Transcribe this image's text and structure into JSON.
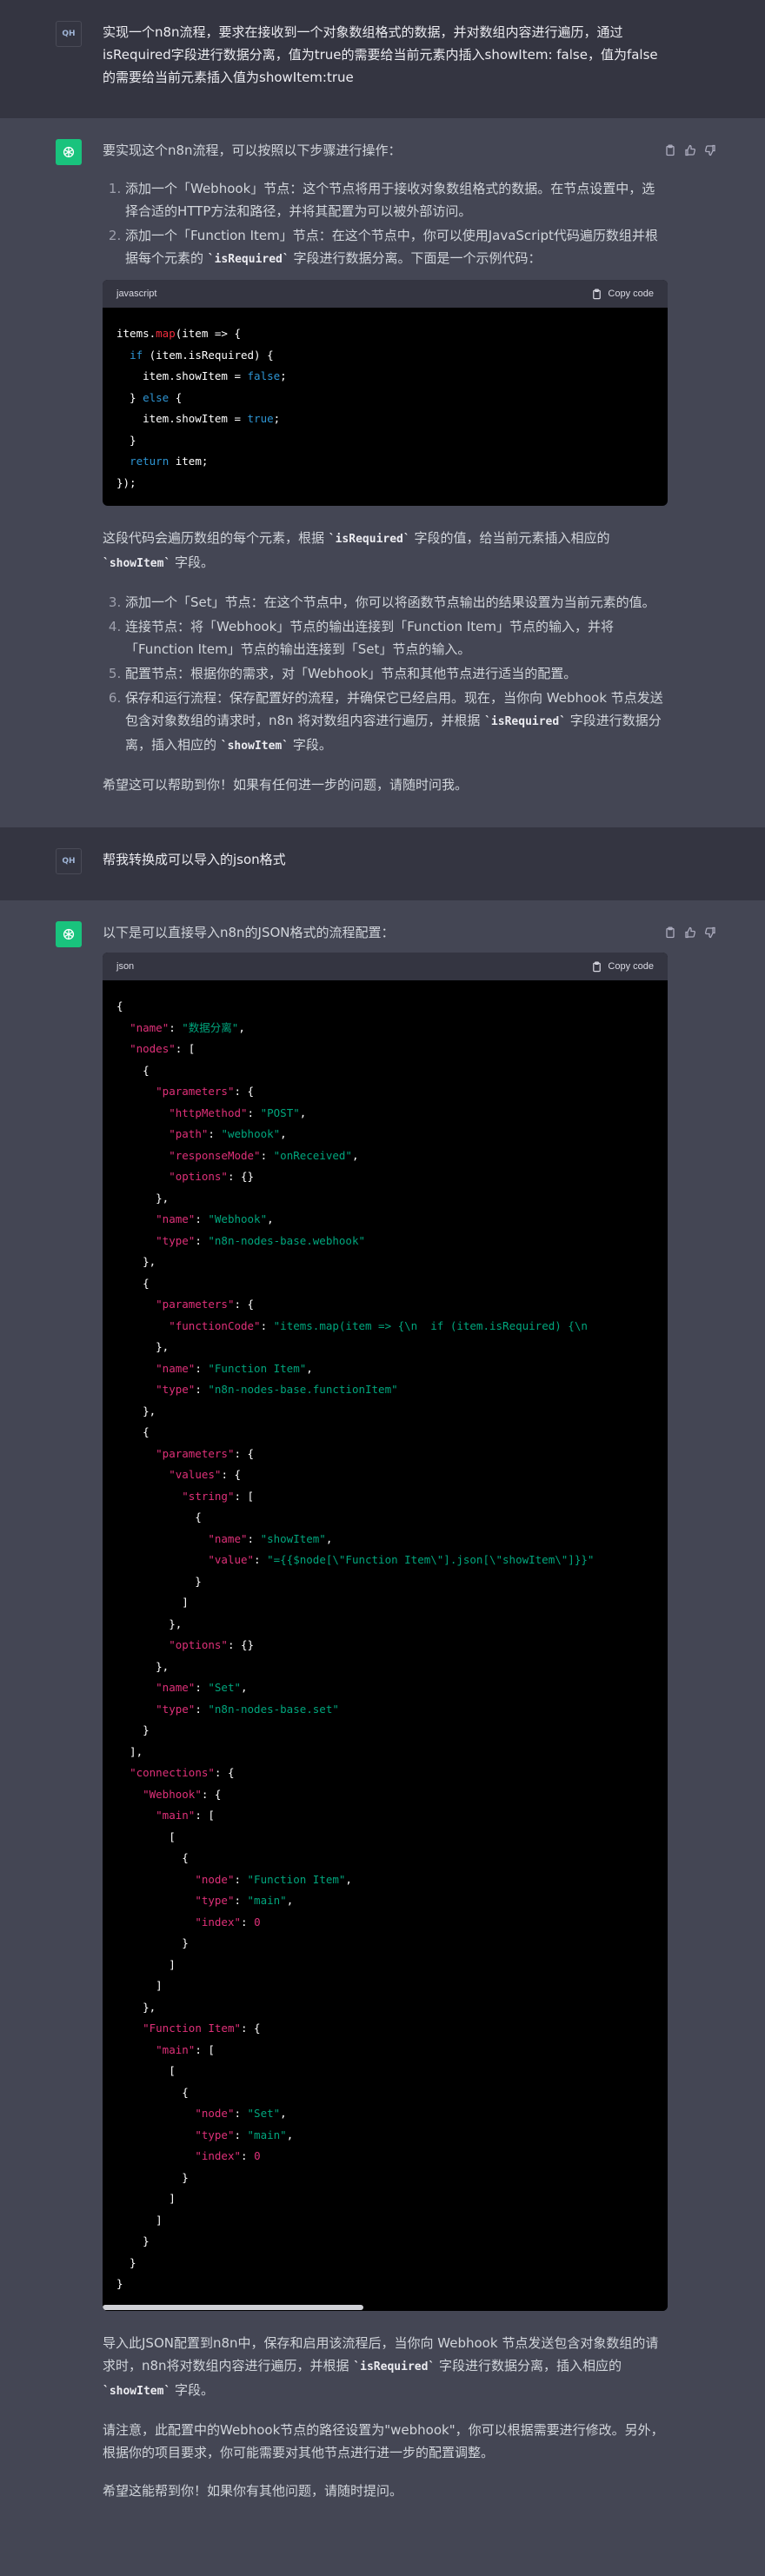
{
  "conversation": {
    "user_avatar": "QH",
    "msg1": {
      "text": "实现一个n8n流程，要求在接收到一个对象数组格式的数据，并对数组内容进行遍历，通过isRequired字段进行数据分离，值为true的需要给当前元素内插入showItem: false，值为false的需要给当前元素插入值为showItem:true"
    },
    "reply1": {
      "intro": "要实现这个n8n流程，可以按照以下步骤进行操作：",
      "steps_a": [
        "添加一个「Webhook」节点：这个节点将用于接收对象数组格式的数据。在节点设置中，选择合适的HTTP方法和路径，并将其配置为可以被外部访问。",
        "添加一个「Function Item」节点：在这个节点中，你可以使用JavaScript代码遍历数组并根据每个元素的 `isRequired` 字段进行数据分离。下面是一个示例代码："
      ],
      "code_lang": "javascript",
      "copy_label": "Copy code",
      "after_code": "这段代码会遍历数组的每个元素，根据 `isRequired` 字段的值，给当前元素插入相应的 `showItem` 字段。",
      "steps_b": [
        "添加一个「Set」节点：在这个节点中，你可以将函数节点输出的结果设置为当前元素的值。",
        "连接节点：将「Webhook」节点的输出连接到「Function Item」节点的输入，并将「Function Item」节点的输出连接到「Set」节点的输入。",
        "配置节点：根据你的需求，对「Webhook」节点和其他节点进行适当的配置。",
        "保存和运行流程：保存配置好的流程，并确保它已经启用。现在，当你向 Webhook 节点发送包含对象数组的请求时，n8n 将对数组内容进行遍历，并根据 `isRequired` 字段进行数据分离，插入相应的 `showItem` 字段。"
      ],
      "closing": "希望这可以帮助到你！如果有任何进一步的问题，请随时问我。"
    },
    "msg2": {
      "text": "帮我转换成可以导入的json格式"
    },
    "reply2": {
      "intro": "以下是可以直接导入n8n的JSON格式的流程配置：",
      "code_lang": "json",
      "copy_label": "Copy code",
      "para1": "导入此JSON配置到n8n中，保存和启用该流程后，当你向 Webhook 节点发送包含对象数组的请求时，n8n将对数组内容进行遍历，并根据 `isRequired` 字段进行数据分离，插入相应的 `showItem` 字段。",
      "para2": "请注意，此配置中的Webhook节点的路径设置为\"webhook\"，你可以根据需要进行修改。另外，根据你的项目要求，你可能需要对其他节点进行进一步的配置调整。",
      "closing": "希望这能帮到你！如果你有其他问题，请随时提问。"
    }
  },
  "code_js": [
    [
      [
        "t",
        "items."
      ],
      [
        "f",
        "map"
      ],
      [
        "t",
        "(item => {"
      ]
    ],
    [
      [
        "t",
        "  "
      ],
      [
        "k",
        "if"
      ],
      [
        "t",
        " (item.isRequired) {"
      ]
    ],
    [
      [
        "t",
        "    item.showItem = "
      ],
      [
        "k",
        "false"
      ],
      [
        "t",
        ";"
      ]
    ],
    [
      [
        "t",
        "  } "
      ],
      [
        "k",
        "else"
      ],
      [
        "t",
        " {"
      ]
    ],
    [
      [
        "t",
        "    item.showItem = "
      ],
      [
        "k",
        "true"
      ],
      [
        "t",
        ";"
      ]
    ],
    [
      [
        "t",
        "  }"
      ]
    ],
    [
      [
        "t",
        "  "
      ],
      [
        "k",
        "return"
      ],
      [
        "t",
        " item;"
      ]
    ],
    [
      [
        "t",
        "});"
      ]
    ]
  ],
  "code_json": [
    [
      [
        "t",
        "{"
      ]
    ],
    [
      [
        "t",
        "  "
      ],
      [
        "p",
        "\"name\""
      ],
      [
        "t",
        ": "
      ],
      [
        "s",
        "\"数据分离\""
      ],
      [
        "t",
        ","
      ]
    ],
    [
      [
        "t",
        "  "
      ],
      [
        "p",
        "\"nodes\""
      ],
      [
        "t",
        ": ["
      ]
    ],
    [
      [
        "t",
        "    {"
      ]
    ],
    [
      [
        "t",
        "      "
      ],
      [
        "p",
        "\"parameters\""
      ],
      [
        "t",
        ": {"
      ]
    ],
    [
      [
        "t",
        "        "
      ],
      [
        "p",
        "\"httpMethod\""
      ],
      [
        "t",
        ": "
      ],
      [
        "s",
        "\"POST\""
      ],
      [
        "t",
        ","
      ]
    ],
    [
      [
        "t",
        "        "
      ],
      [
        "p",
        "\"path\""
      ],
      [
        "t",
        ": "
      ],
      [
        "s",
        "\"webhook\""
      ],
      [
        "t",
        ","
      ]
    ],
    [
      [
        "t",
        "        "
      ],
      [
        "p",
        "\"responseMode\""
      ],
      [
        "t",
        ": "
      ],
      [
        "s",
        "\"onReceived\""
      ],
      [
        "t",
        ","
      ]
    ],
    [
      [
        "t",
        "        "
      ],
      [
        "p",
        "\"options\""
      ],
      [
        "t",
        ": {}"
      ]
    ],
    [
      [
        "t",
        "      },"
      ]
    ],
    [
      [
        "t",
        "      "
      ],
      [
        "p",
        "\"name\""
      ],
      [
        "t",
        ": "
      ],
      [
        "s",
        "\"Webhook\""
      ],
      [
        "t",
        ","
      ]
    ],
    [
      [
        "t",
        "      "
      ],
      [
        "p",
        "\"type\""
      ],
      [
        "t",
        ": "
      ],
      [
        "s",
        "\"n8n-nodes-base.webhook\""
      ]
    ],
    [
      [
        "t",
        "    },"
      ]
    ],
    [
      [
        "t",
        "    {"
      ]
    ],
    [
      [
        "t",
        "      "
      ],
      [
        "p",
        "\"parameters\""
      ],
      [
        "t",
        ": {"
      ]
    ],
    [
      [
        "t",
        "        "
      ],
      [
        "p",
        "\"functionCode\""
      ],
      [
        "t",
        ": "
      ],
      [
        "s",
        "\"items.map(item => {\\n  if (item.isRequired) {\\n"
      ]
    ],
    [
      [
        "t",
        "      },"
      ]
    ],
    [
      [
        "t",
        "      "
      ],
      [
        "p",
        "\"name\""
      ],
      [
        "t",
        ": "
      ],
      [
        "s",
        "\"Function Item\""
      ],
      [
        "t",
        ","
      ]
    ],
    [
      [
        "t",
        "      "
      ],
      [
        "p",
        "\"type\""
      ],
      [
        "t",
        ": "
      ],
      [
        "s",
        "\"n8n-nodes-base.functionItem\""
      ]
    ],
    [
      [
        "t",
        "    },"
      ]
    ],
    [
      [
        "t",
        "    {"
      ]
    ],
    [
      [
        "t",
        "      "
      ],
      [
        "p",
        "\"parameters\""
      ],
      [
        "t",
        ": {"
      ]
    ],
    [
      [
        "t",
        "        "
      ],
      [
        "p",
        "\"values\""
      ],
      [
        "t",
        ": {"
      ]
    ],
    [
      [
        "t",
        "          "
      ],
      [
        "p",
        "\"string\""
      ],
      [
        "t",
        ": ["
      ]
    ],
    [
      [
        "t",
        "            {"
      ]
    ],
    [
      [
        "t",
        "              "
      ],
      [
        "p",
        "\"name\""
      ],
      [
        "t",
        ": "
      ],
      [
        "s",
        "\"showItem\""
      ],
      [
        "t",
        ","
      ]
    ],
    [
      [
        "t",
        "              "
      ],
      [
        "p",
        "\"value\""
      ],
      [
        "t",
        ": "
      ],
      [
        "s",
        "\"={{$node[\\\"Function Item\\\"].json[\\\"showItem\\\"]}}\""
      ]
    ],
    [
      [
        "t",
        "            }"
      ]
    ],
    [
      [
        "t",
        "          ]"
      ]
    ],
    [
      [
        "t",
        "        },"
      ]
    ],
    [
      [
        "t",
        "        "
      ],
      [
        "p",
        "\"options\""
      ],
      [
        "t",
        ": {}"
      ]
    ],
    [
      [
        "t",
        "      },"
      ]
    ],
    [
      [
        "t",
        "      "
      ],
      [
        "p",
        "\"name\""
      ],
      [
        "t",
        ": "
      ],
      [
        "s",
        "\"Set\""
      ],
      [
        "t",
        ","
      ]
    ],
    [
      [
        "t",
        "      "
      ],
      [
        "p",
        "\"type\""
      ],
      [
        "t",
        ": "
      ],
      [
        "s",
        "\"n8n-nodes-base.set\""
      ]
    ],
    [
      [
        "t",
        "    }"
      ]
    ],
    [
      [
        "t",
        "  ],"
      ]
    ],
    [
      [
        "t",
        "  "
      ],
      [
        "p",
        "\"connections\""
      ],
      [
        "t",
        ": {"
      ]
    ],
    [
      [
        "t",
        "    "
      ],
      [
        "p",
        "\"Webhook\""
      ],
      [
        "t",
        ": {"
      ]
    ],
    [
      [
        "t",
        "      "
      ],
      [
        "p",
        "\"main\""
      ],
      [
        "t",
        ": ["
      ]
    ],
    [
      [
        "t",
        "        ["
      ]
    ],
    [
      [
        "t",
        "          {"
      ]
    ],
    [
      [
        "t",
        "            "
      ],
      [
        "p",
        "\"node\""
      ],
      [
        "t",
        ": "
      ],
      [
        "s",
        "\"Function Item\""
      ],
      [
        "t",
        ","
      ]
    ],
    [
      [
        "t",
        "            "
      ],
      [
        "p",
        "\"type\""
      ],
      [
        "t",
        ": "
      ],
      [
        "s",
        "\"main\""
      ],
      [
        "t",
        ","
      ]
    ],
    [
      [
        "t",
        "            "
      ],
      [
        "p",
        "\"index\""
      ],
      [
        "t",
        ": "
      ],
      [
        "n",
        "0"
      ]
    ],
    [
      [
        "t",
        "          }"
      ]
    ],
    [
      [
        "t",
        "        ]"
      ]
    ],
    [
      [
        "t",
        "      ]"
      ]
    ],
    [
      [
        "t",
        "    },"
      ]
    ],
    [
      [
        "t",
        "    "
      ],
      [
        "p",
        "\"Function Item\""
      ],
      [
        "t",
        ": {"
      ]
    ],
    [
      [
        "t",
        "      "
      ],
      [
        "p",
        "\"main\""
      ],
      [
        "t",
        ": ["
      ]
    ],
    [
      [
        "t",
        "        ["
      ]
    ],
    [
      [
        "t",
        "          {"
      ]
    ],
    [
      [
        "t",
        "            "
      ],
      [
        "p",
        "\"node\""
      ],
      [
        "t",
        ": "
      ],
      [
        "s",
        "\"Set\""
      ],
      [
        "t",
        ","
      ]
    ],
    [
      [
        "t",
        "            "
      ],
      [
        "p",
        "\"type\""
      ],
      [
        "t",
        ": "
      ],
      [
        "s",
        "\"main\""
      ],
      [
        "t",
        ","
      ]
    ],
    [
      [
        "t",
        "            "
      ],
      [
        "p",
        "\"index\""
      ],
      [
        "t",
        ": "
      ],
      [
        "n",
        "0"
      ]
    ],
    [
      [
        "t",
        "          }"
      ]
    ],
    [
      [
        "t",
        "        ]"
      ]
    ],
    [
      [
        "t",
        "      ]"
      ]
    ],
    [
      [
        "t",
        "    }"
      ]
    ],
    [
      [
        "t",
        "  }"
      ]
    ],
    [
      [
        "t",
        "}"
      ]
    ]
  ],
  "colors": {
    "user_bg": "#343541",
    "assistant_bg": "#444654",
    "gpt_green": "#19c37d"
  },
  "icons": {
    "copy": "clipboard-icon",
    "thumbs_up": "thumbs-up-icon",
    "thumbs_down": "thumbs-down-icon",
    "gpt": "openai-logo-icon"
  }
}
